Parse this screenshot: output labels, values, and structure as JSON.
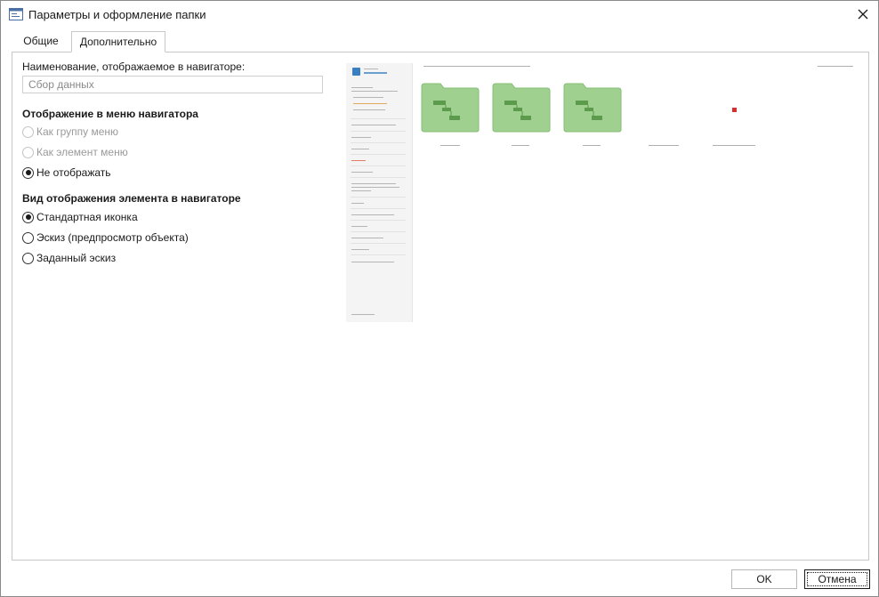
{
  "window": {
    "title": "Параметры и оформление папки",
    "icon": "folder-settings-window-icon",
    "close_icon": "close-icon"
  },
  "tabs": [
    {
      "label": "Общие",
      "active": false
    },
    {
      "label": "Дополнительно",
      "active": true
    }
  ],
  "name_field": {
    "label": "Наименование, отображаемое в навигаторе:",
    "placeholder": "Сбор данных",
    "value": ""
  },
  "menu_display": {
    "title": "Отображение в меню навигатора",
    "options": [
      {
        "label": "Как группу меню",
        "checked": false,
        "disabled": true
      },
      {
        "label": "Как элемент меню",
        "checked": false,
        "disabled": true
      },
      {
        "label": "Не отображать",
        "checked": true,
        "disabled": false
      }
    ]
  },
  "element_view": {
    "title": "Вид отображения элемента в навигаторе",
    "options": [
      {
        "label": "Стандартная иконка",
        "checked": true
      },
      {
        "label": "Эскиз (предпросмотр объекта)",
        "checked": false
      },
      {
        "label": "Заданный эскиз",
        "checked": false
      }
    ]
  },
  "preview": {
    "logo_icon": "app-logo-icon",
    "folder_icon": "folder-icon",
    "folder_color": "#9fd08f",
    "folder_count": 3,
    "report_icon": "red-report-icon"
  },
  "buttons": {
    "ok": "OK",
    "cancel": "Отмена"
  },
  "colors": {
    "accent": "#3a7fc1",
    "folder": "#9fd08f",
    "folder_dark": "#7ab76a"
  }
}
